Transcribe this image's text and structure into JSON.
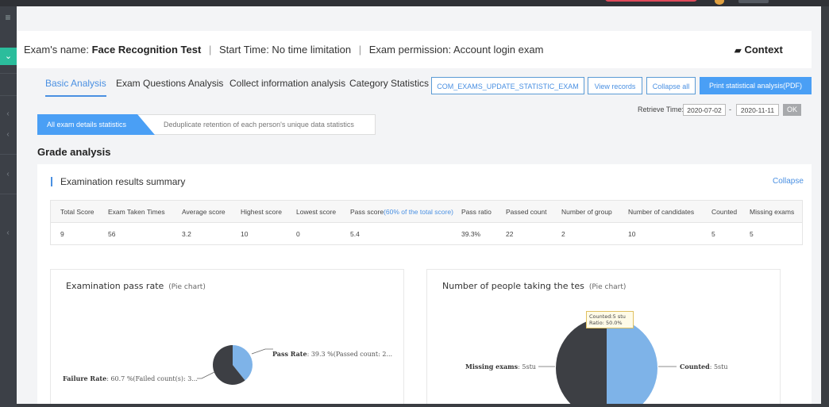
{
  "header": {
    "exam_name_label": "Exam's name:",
    "exam_name": "Face Recognition Test",
    "start_time": "Start Time: No time limitation",
    "permission": "Exam permission: Account login exam",
    "separator": "|",
    "context_label": "Context"
  },
  "tabs": [
    "Basic Analysis",
    "Exam Questions Analysis",
    "Collect information analysis",
    "Category Statistics"
  ],
  "buttons": {
    "update": "COM_EXAMS_UPDATE_STATISTIC_EXAM",
    "view_records": "View records",
    "collapse_all": "Collapse all",
    "print": "Print statistical analysis(PDF)"
  },
  "retrieve": {
    "label": "Retrieve Time:",
    "from": "2020-07-02",
    "dash": "-",
    "to": "2020-11-11",
    "ok": "OK"
  },
  "stat_tabs": {
    "active": "All exam details statistics",
    "other": "Deduplicate retention of each person's unique data statistics"
  },
  "section": {
    "grade_title": "Grade analysis",
    "summary_title": "Examination results summary",
    "collapse": "Collapse"
  },
  "table": {
    "headers": [
      "Total Score",
      "Exam Taken Times",
      "Average score",
      "Highest score",
      "Lowest score",
      "Pass score",
      "Pass ratio",
      "Passed count",
      "Number of group",
      "Number of candidates",
      "Counted",
      "Missing exams"
    ],
    "pass_score_note": "(60% of the total score)",
    "row": [
      "9",
      "56",
      "3.2",
      "10",
      "0",
      "5.4",
      "39.3%",
      "22",
      "2",
      "10",
      "5",
      "5"
    ]
  },
  "charts": {
    "pass_rate": {
      "title": "Examination pass rate",
      "subtitle": "(Pie chart)",
      "pass_name": "Pass Rate",
      "pass_text": ": 39.3 %(Passed count: 2...",
      "fail_name": "Failure Rate",
      "fail_text": ": 60.7 %(Failed count(s): 3..."
    },
    "people": {
      "title": "Number of people taking the tes",
      "subtitle": "(Pie chart)",
      "missing_name": "Missing exams",
      "missing_text": ": 5stu",
      "counted_name": "Counted",
      "counted_text": ": 5stu",
      "tooltip_line1": "Counted:5 stu",
      "tooltip_line2": "Ratio: 50.0%"
    }
  },
  "chart_data": [
    {
      "type": "pie",
      "title": "Examination pass rate",
      "slices": [
        {
          "name": "Pass Rate",
          "value": 39.3,
          "color": "#7eb3e8"
        },
        {
          "name": "Failure Rate",
          "value": 60.7,
          "color": "#3d3f44"
        }
      ]
    },
    {
      "type": "pie",
      "title": "Number of people taking the tes",
      "slices": [
        {
          "name": "Counted",
          "value": 5,
          "color": "#7eb3e8"
        },
        {
          "name": "Missing exams",
          "value": 5,
          "color": "#3d3f44"
        }
      ]
    }
  ]
}
